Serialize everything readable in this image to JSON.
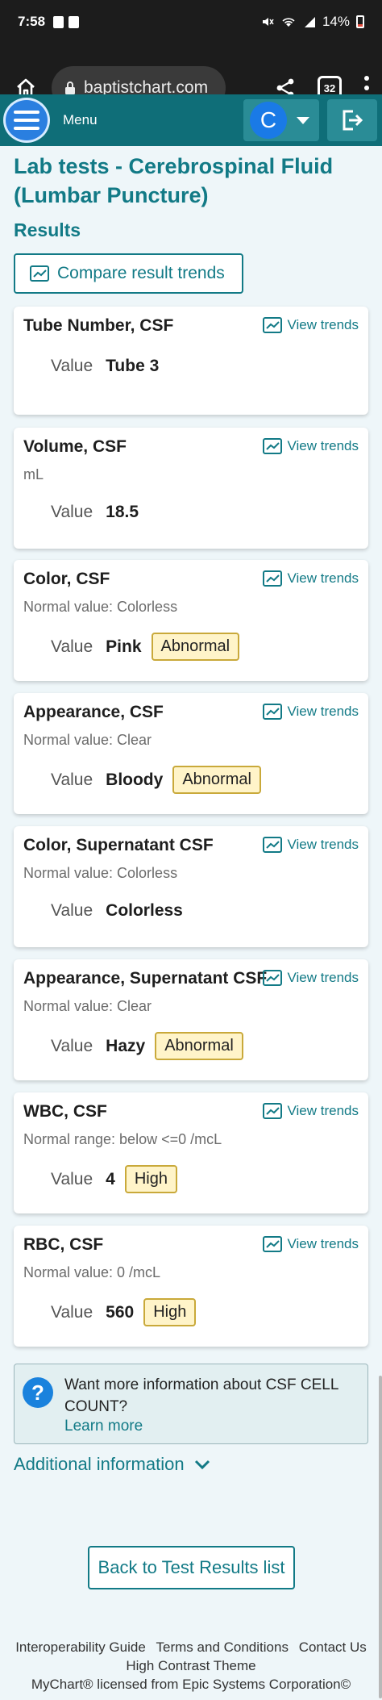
{
  "status_bar": {
    "time": "7:58",
    "battery": "14%"
  },
  "browser": {
    "url": "baptistchart.com",
    "tab_count": "32"
  },
  "header": {
    "menu_label": "Menu",
    "avatar_letter": "C"
  },
  "page": {
    "title": "Lab tests - Cerebrospinal Fluid (Lumbar Puncture)",
    "section": "Results",
    "compare_label": "Compare result trends"
  },
  "value_label": "Value",
  "view_trends_label": "View trends",
  "results": [
    {
      "name": "Tube Number, CSF",
      "sub": "",
      "value": "Tube 3",
      "flag": ""
    },
    {
      "name": "Volume, CSF",
      "sub": "mL",
      "value": "18.5",
      "flag": ""
    },
    {
      "name": "Color, CSF",
      "sub": "Normal value: Colorless",
      "value": "Pink",
      "flag": "Abnormal"
    },
    {
      "name": "Appearance, CSF",
      "sub": "Normal value: Clear",
      "value": "Bloody",
      "flag": "Abnormal"
    },
    {
      "name": "Color, Supernatant CSF",
      "sub": "Normal value: Colorless",
      "value": "Colorless",
      "flag": ""
    },
    {
      "name": "Appearance, Supernatant CSF",
      "sub": "Normal value: Clear",
      "value": "Hazy",
      "flag": "Abnormal"
    },
    {
      "name": "WBC, CSF",
      "sub": "Normal range: below <=0 /mcL",
      "value": "4",
      "flag": "High"
    },
    {
      "name": "RBC, CSF",
      "sub": "Normal value: 0 /mcL",
      "value": "560",
      "flag": "High"
    }
  ],
  "info": {
    "text": "Want more information about CSF CELL COUNT?",
    "link": "Learn more"
  },
  "additional_label": "Additional information",
  "back_label": "Back to Test Results list",
  "footer": {
    "interop": "Interoperability Guide",
    "terms": "Terms and Conditions",
    "contact": "Contact Us",
    "contrast": "High Contrast Theme",
    "license": "MyChart® licensed from Epic Systems Corporation©"
  }
}
